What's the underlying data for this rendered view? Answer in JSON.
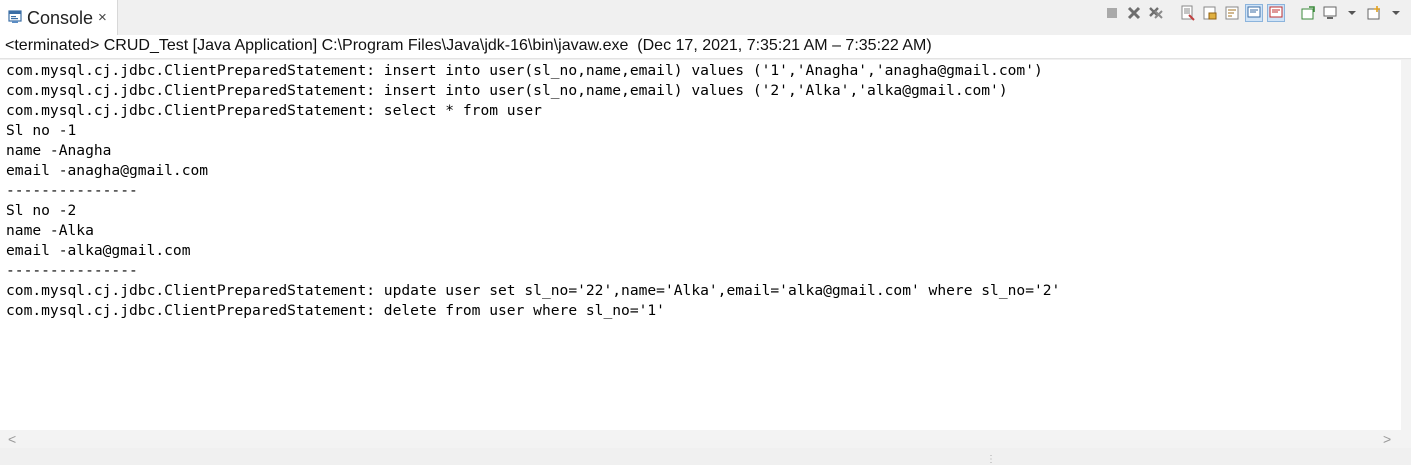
{
  "tab": {
    "label": "Console",
    "icon": "console-icon",
    "close": "×"
  },
  "toolbar": {
    "icons": [
      "terminate-icon",
      "remove-launch-icon",
      "remove-all-terminated-icon",
      "clear-console-icon",
      "scroll-lock-icon",
      "word-wrap-icon",
      "show-on-stdout-icon",
      "show-on-stderr-icon",
      "pin-console-icon",
      "display-selected-console-icon",
      "open-console-icon",
      "view-menu-icon"
    ]
  },
  "status": {
    "text": "<terminated> CRUD_Test [Java Application] C:\\Program Files\\Java\\jdk-16\\bin\\javaw.exe  (Dec 17, 2021, 7:35:21 AM – 7:35:22 AM)"
  },
  "console": {
    "lines": [
      "com.mysql.cj.jdbc.ClientPreparedStatement: insert into user(sl_no,name,email) values ('1','Anagha','anagha@gmail.com')",
      "com.mysql.cj.jdbc.ClientPreparedStatement: insert into user(sl_no,name,email) values ('2','Alka','alka@gmail.com')",
      "com.mysql.cj.jdbc.ClientPreparedStatement: select * from user",
      "Sl no -1",
      "name -Anagha",
      "email -anagha@gmail.com",
      "---------------",
      "Sl no -2",
      "name -Alka",
      "email -alka@gmail.com",
      "---------------",
      "com.mysql.cj.jdbc.ClientPreparedStatement: update user set sl_no='22',name='Alka',email='alka@gmail.com' where sl_no='2'",
      "com.mysql.cj.jdbc.ClientPreparedStatement: delete from user where sl_no='1'"
    ]
  },
  "scrollbar": {
    "left_arrow": "<",
    "right_arrow": ">"
  }
}
